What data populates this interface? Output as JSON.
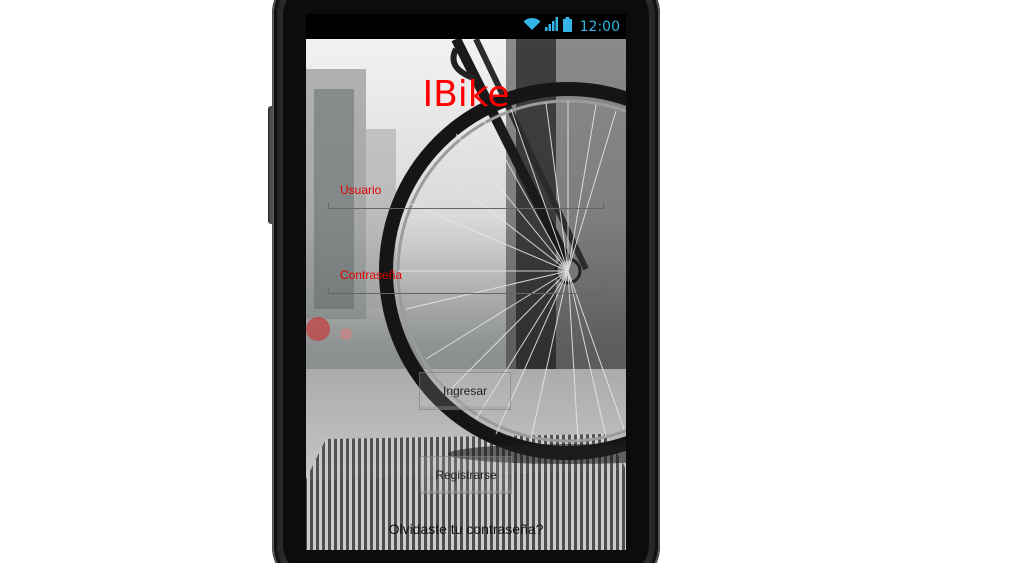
{
  "status_bar": {
    "time": "12:00",
    "icons": [
      "wifi-icon",
      "signal-icon",
      "battery-icon"
    ],
    "accent_color": "#33b5e5"
  },
  "app": {
    "title": "IBike",
    "title_color": "#ff0000"
  },
  "form": {
    "username_label": "Usuario",
    "password_label": "Contraseña",
    "label_color": "#e00000",
    "login_button": "Ingresar",
    "register_button": "Registrarse",
    "forgot_link": "Olvidaste tu contraseña?"
  }
}
